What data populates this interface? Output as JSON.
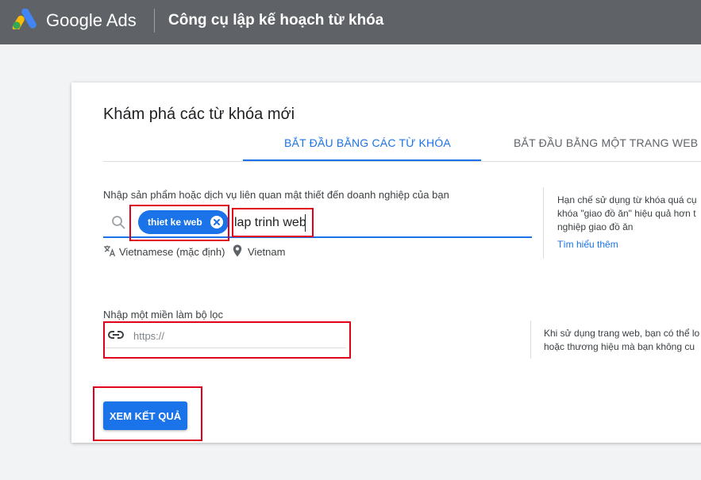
{
  "header": {
    "brand": "Google Ads",
    "title": "Công cụ lập kế hoạch từ khóa"
  },
  "card": {
    "title": "Khám phá các từ khóa mới",
    "tabs": [
      {
        "label": "BẮT ĐẦU BẰNG CÁC TỪ KHÓA",
        "active": true
      },
      {
        "label": "BẮT ĐẦU BẰNG MỘT TRANG WEB",
        "active": false
      }
    ]
  },
  "keywords": {
    "label": "Nhập sản phẩm hoặc dịch vụ liên quan mật thiết đến doanh nghiệp của bạn",
    "chips": [
      {
        "label": "thiet ke web"
      }
    ],
    "input_value": "lap trinh web",
    "language": "Vietnamese (mặc định)",
    "location": "Vietnam"
  },
  "hint_keywords": {
    "lines": [
      "Hạn chế sử dụng từ khóa quá cụ",
      "khóa \"giao đồ ăn\" hiệu quả hơn t",
      "nghiệp giao đồ ăn"
    ],
    "link": "Tìm hiểu thêm"
  },
  "filter": {
    "label": "Nhập một miền làm bộ lọc",
    "placeholder": "https://"
  },
  "hint_filter": {
    "lines": [
      "Khi sử dụng trang web, bạn có thể lo",
      "hoặc thương hiệu mà bạn không cu"
    ]
  },
  "submit_label": "XEM KẾT QUẢ",
  "colors": {
    "accent": "#1a73e8",
    "topbar": "#5f6368",
    "annotation": "#e0001b"
  }
}
